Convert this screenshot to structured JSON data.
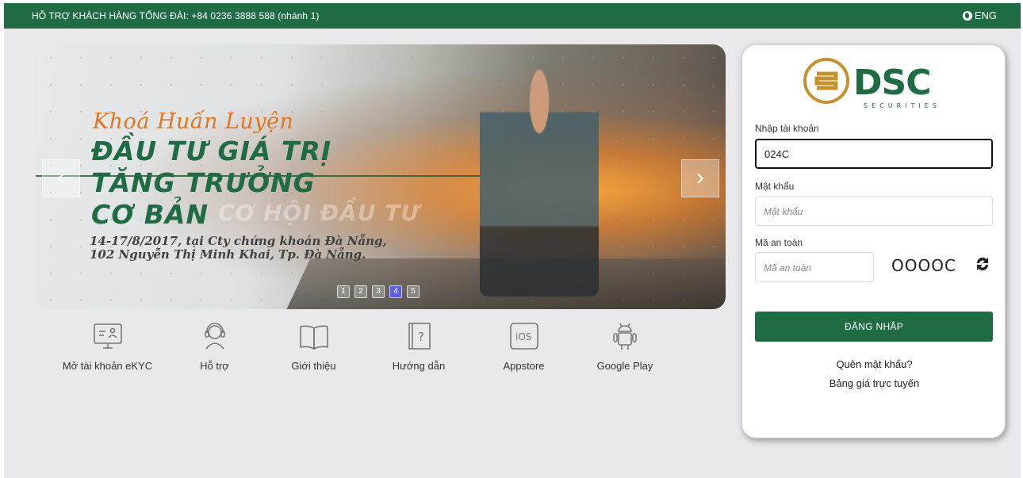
{
  "topbar": {
    "hotline": "HỖ TRỢ KHÁCH HÀNG TỔNG ĐÀI: +84 0236 3888 588 (nhánh 1)",
    "language": "ENG",
    "language_icon": "globe-icon",
    "background": "#1f6b44"
  },
  "banner": {
    "script_title": "Khoá Huấn Luyện",
    "heading_line1": "ĐẦU TƯ GIÁ TRỊ",
    "heading_line2": "TĂNG TRƯỞNG",
    "heading_line3": "CƠ BẢN",
    "ghost_text": "CƠ HỘI ĐẦU TƯ",
    "info_line1": "14-17/8/2017, tại Cty chứng khoán Đà Nẵng,",
    "info_line2": "102 Nguyễn Thị Minh Khai, Tp. Đà Nẵng.",
    "prev_symbol": "‹",
    "next_symbol": "›",
    "slides": [
      "1",
      "2",
      "3",
      "4",
      "5"
    ],
    "active_slide": "4"
  },
  "quick_links": [
    {
      "label": "Mở tài khoản eKYC",
      "icon": "ekyc-monitor-icon"
    },
    {
      "label": "Hỗ trợ",
      "icon": "headset-support-icon"
    },
    {
      "label": "Giới thiệu",
      "icon": "open-book-icon"
    },
    {
      "label": "Hướng dẫn",
      "icon": "help-book-icon"
    },
    {
      "label": "Appstore",
      "icon": "ios-icon"
    },
    {
      "label": "Google Play",
      "icon": "android-icon"
    }
  ],
  "login": {
    "logo_text": "DSC",
    "logo_sub": "SECURITIES",
    "account_label": "Nhập tài khoản",
    "account_value": "024C",
    "password_label": "Mật khẩu",
    "password_placeholder": "Mật khẩu",
    "captcha_label": "Mã an toàn",
    "captcha_placeholder": "Mã an toàn",
    "captcha_code": "OOOOC",
    "login_button": "ĐĂNG NHẬP",
    "forgot_password": "Quên mật khẩu?",
    "price_board": "Bảng giá trực tuyến",
    "accent": "#1f6b44",
    "logo_gold": "#c6922f"
  }
}
